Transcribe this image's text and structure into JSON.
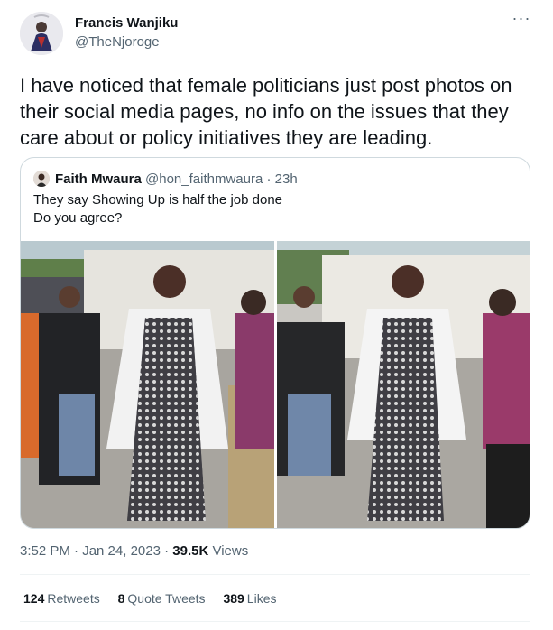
{
  "author": {
    "name": "Francis Wanjiku",
    "handle": "@TheNjoroge"
  },
  "tweet": {
    "text": "I have noticed that female politicians just post photos on their social media pages, no info on the issues that they care about or policy initiatives they are leading."
  },
  "quoted_tweet": {
    "name": "Faith Mwaura",
    "handle_time": "@hon_faithmwaura · 23h",
    "text_lines": [
      "They say Showing Up is half the job done",
      "Do you agree?"
    ]
  },
  "meta": {
    "time_date": "3:52 PM · Jan 24, 2023 · ",
    "views_count": "39.5K",
    "views_label": " Views"
  },
  "stats": {
    "retweets_count": "124",
    "retweets_label": "Retweets",
    "quotes_count": "8",
    "quotes_label": "Quote Tweets",
    "likes_count": "389",
    "likes_label": "Likes"
  },
  "icons": {
    "more": "more-icon",
    "avatar": "avatar"
  },
  "colors": {
    "text": "#0f1419",
    "secondary": "#536471",
    "border": "#cfd9de"
  }
}
